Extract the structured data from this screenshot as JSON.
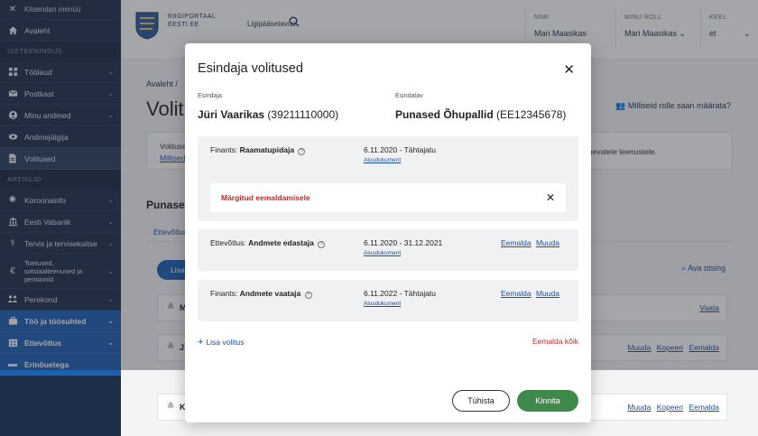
{
  "sidebar": {
    "close_label": "Kitsendan menüü",
    "home": "Avaleht",
    "section_iseteenindus": "ISETEENINDUS",
    "items_self": [
      {
        "label": "Töölaud",
        "chev": "⌄"
      },
      {
        "label": "Postkast",
        "chev": "⌄"
      },
      {
        "label": "Minu andmed",
        "chev": "⌄"
      },
      {
        "label": "Andmejälgija",
        "chev": ""
      },
      {
        "label": "Volitused",
        "chev": ""
      }
    ],
    "section_artiklid": "ARTIKLID",
    "items_articles": [
      {
        "label": "Koroonainfo",
        "chev": "⌄"
      },
      {
        "label": "Eesti Vabariik",
        "chev": "⌄"
      },
      {
        "label": "Tervis ja tervisekaitse",
        "chev": "⌄"
      }
    ],
    "multi_item": {
      "label": "Toetused, sotsiaalteenused ja pensionid",
      "chev": "⌄"
    },
    "items_more": [
      {
        "label": "Perekond",
        "chev": "⌄"
      }
    ],
    "items_bright": [
      {
        "label": "Töö ja töösuhted",
        "chev": "⌄"
      },
      {
        "label": "Ettevõtlus",
        "chev": "⌄"
      },
      {
        "label": "Erinõuetega",
        "chev": ""
      }
    ]
  },
  "header": {
    "portal_line1": "RIIGIPORTAAL",
    "portal_line2": "EESTI.EE",
    "access": "Ligipääsetavus",
    "name_label": "NIMI",
    "name_value": "Mari Maasikas",
    "role_label": "MINU ROLL",
    "role_value": "Mari Maasikas ⌄",
    "lang_label": "KEEL",
    "lang_value": "et",
    "lang_chev": "⌄"
  },
  "page": {
    "breadcrumb": "Avaleht /",
    "title": "Volitused",
    "roles_link": "Milliseid rolle saan määrata?",
    "info_line1": "Volitused",
    "info_line2": "Millised",
    "info_right": "õigusid erinevatele teenustele.",
    "company_title": "Punased Õhupallid",
    "tab": "Ettevõtlus",
    "pill": "Lisa",
    "search": "Ava otsing",
    "rows": [
      {
        "initial": "M",
        "actions": [
          "Vaata"
        ]
      },
      {
        "initial": "J",
        "actions": [
          "Muuda",
          "Kopeeri",
          "Eemalda"
        ]
      },
      {
        "initial": "K",
        "actions": [
          "Muuda",
          "Kopeeri",
          "Eemalda"
        ]
      }
    ]
  },
  "modal": {
    "title": "Esindaja volitused",
    "representative_label": "Esindaja",
    "representative_name": "Jüri Vaarikas",
    "representative_code": "(39211110000)",
    "represented_label": "Esindatav",
    "represented_name": "Punased Õhupallid",
    "represented_code": "(EE12345678)",
    "mandates": [
      {
        "area": "Finants:",
        "role": "Raamatupidaja",
        "dates": "6.11.2020 - Tähtajatu",
        "document": "Alusdokument",
        "actions": [],
        "removed_text": "Märgitud eemaldamisele"
      },
      {
        "area": "Ettevõtlus:",
        "role": "Andmete edastaja",
        "dates": "6.11.2020 - 31.12.2021",
        "document": "Alusdokument",
        "actions": [
          "Eemalda",
          "Muuda"
        ]
      },
      {
        "area": "Finants:",
        "role": "Andmete vaataja",
        "dates": "6.11.2022 - Tähtajatu",
        "document": "Alusdokument",
        "actions": [
          "Eemalda",
          "Muuda"
        ]
      }
    ],
    "add_label": "Lisa volitus",
    "remove_all": "Eemalda kõik",
    "cancel": "Tühista",
    "confirm": "Kinnita"
  },
  "colors": {
    "sidebar_bg": "#1f2f4a",
    "accent_blue": "#1d5fb3",
    "confirm_green": "#3f8a4a",
    "danger_red": "#c62828"
  }
}
